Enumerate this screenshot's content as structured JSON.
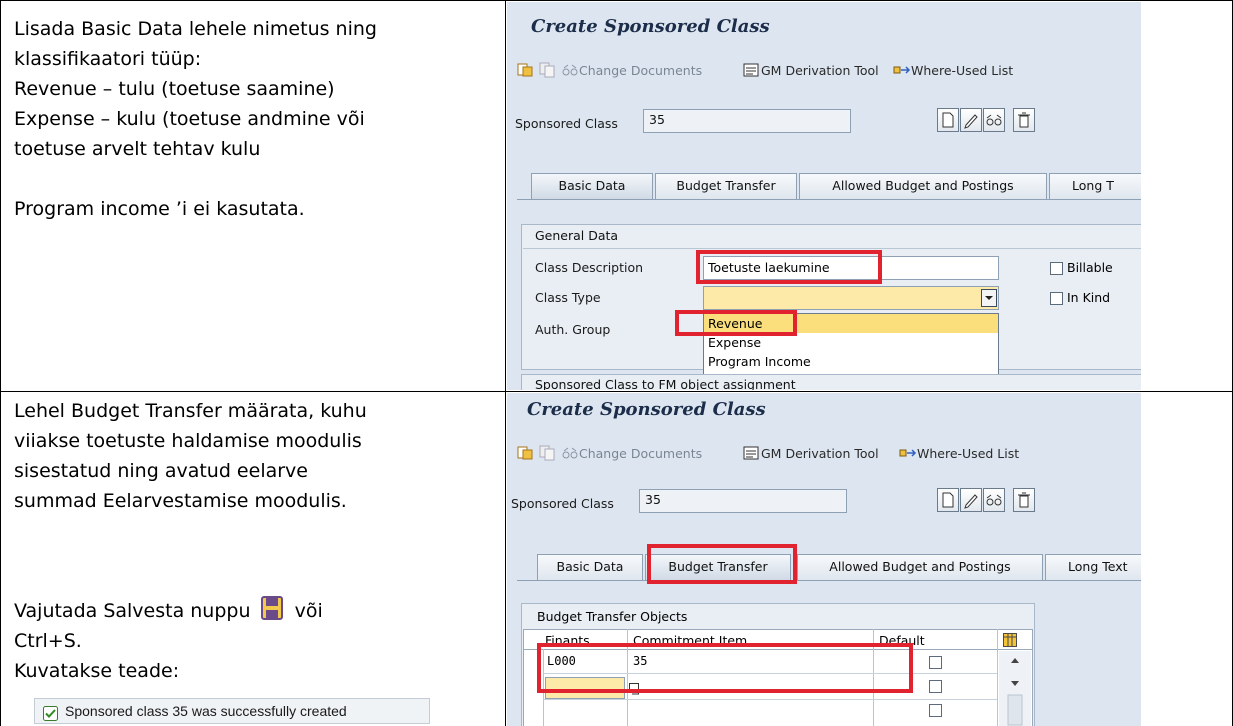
{
  "left_top": {
    "lines": [
      "Lisada Basic Data lehele nimetus ning",
      "klassifikaatori tüüp:",
      "Revenue – tulu (toetuse saamine)",
      "Expense – kulu (toetuse andmine või",
      "toetuse arvelt tehtav kulu",
      "",
      "Program income ’i ei kasutata."
    ]
  },
  "left_bottom": {
    "lines": [
      "Lehel Budget Transfer määrata, kuhu",
      "viiakse toetuste haldamise moodulis",
      "sisestatud ning avatud eelarve",
      "summad Eelarvestamise moodulis."
    ],
    "save_line_prefix": "Vajutada Salvesta nuppu",
    "save_line_suffix": "või",
    "save_icon": "floppy-disk-icon",
    "ctrl_line": "Ctrl+S.",
    "shown_line": "Kuvatakse teade:",
    "message": "Sponsored class 35 was successfully created",
    "message_icon": "checkmark-icon"
  },
  "screen1": {
    "title": "Create Sponsored Class",
    "toolbar": {
      "change_documents": "Change Documents",
      "gm_derivation": "GM Derivation Tool",
      "where_used": "Where-Used List"
    },
    "sponsored_class_label": "Sponsored Class",
    "sponsored_class_value": "35",
    "tabs": [
      "Basic Data",
      "Budget Transfer",
      "Allowed Budget and Postings",
      "Long T"
    ],
    "active_tab": "Basic Data",
    "group_title": "General Data",
    "class_description_label": "Class Description",
    "class_description_value": "Toetuste laekumine",
    "class_type_label": "Class Type",
    "auth_group_label": "Auth. Group",
    "dropdown_options": [
      "Revenue",
      "Expense",
      "Program Income"
    ],
    "selected_option": "Revenue",
    "billable_label": "Billable",
    "in_kind_label": "In Kind",
    "bottom_group": "Sponsored Class to FM object assignment"
  },
  "screen2": {
    "title": "Create Sponsored Class",
    "toolbar": {
      "change_documents": "Change Documents",
      "gm_derivation": "GM Derivation Tool",
      "where_used": "Where-Used List"
    },
    "sponsored_class_label": "Sponsored Class",
    "sponsored_class_value": "35",
    "tabs": [
      "Basic Data",
      "Budget Transfer",
      "Allowed Budget and Postings",
      "Long Text"
    ],
    "active_tab": "Budget Transfer",
    "table_title": "Budget Transfer Objects",
    "columns": [
      "Finants...",
      "Commitment Item",
      "Default"
    ],
    "rows": [
      {
        "finants": "L000",
        "commitment": "35"
      }
    ]
  },
  "colors": {
    "highlight_red": "#e0232e",
    "sap_background": "#dde6f0",
    "required_yellow": "#fde9a8"
  }
}
